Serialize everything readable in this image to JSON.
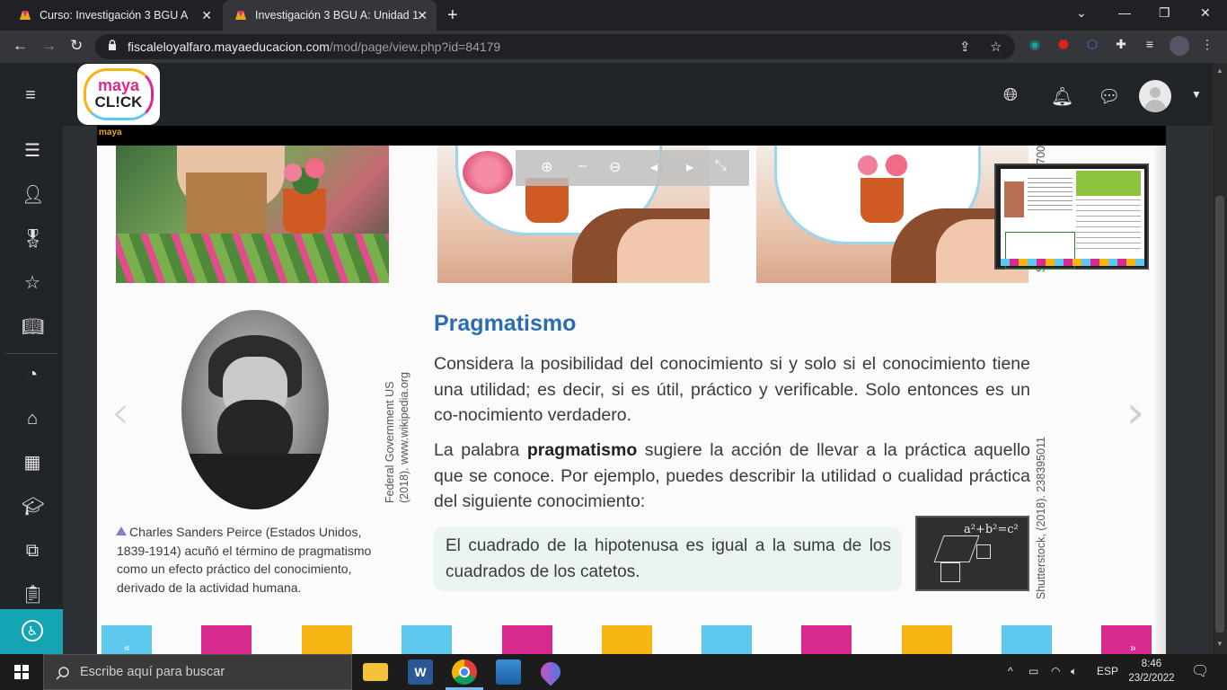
{
  "browser": {
    "tabs": [
      {
        "title": "Curso: Investigación 3 BGU A",
        "active": false
      },
      {
        "title": "Investigación 3 BGU A: Unidad 1",
        "active": true
      }
    ],
    "url_domain": "fiscaleloyalfaro.mayaeducacion.com",
    "url_path": "/mod/page/view.php?id=84179"
  },
  "header": {
    "logo_top": "maya",
    "logo_bottom": "CL!CK"
  },
  "book": {
    "brand": "maya",
    "section_title": "Pragmatismo",
    "paragraph1": "Considera la posibilidad del conocimiento si y solo si el conocimiento tiene una utilidad; es decir, si es útil, práctico y verificable. Solo entonces es un co-nocimiento verdadero.",
    "paragraph2_before": "La palabra ",
    "paragraph2_bold": "pragmatismo",
    "paragraph2_after": " sugiere la acción de llevar a la práctica aquello que se conoce. Por ejemplo, puedes describir la utilidad o cualidad práctica del siguiente conocimiento:",
    "example": "El cuadrado de la hipotenusa es igual a la suma de los cuadrados de los catetos.",
    "caption": "Charles Sanders Peirce (Estados Unidos, 1839-1914) acuñó el término de pragmatismo como un efecto práctico del conocimiento, derivado de la actividad humana.",
    "credit_portrait": "Federal Government US (2018). www.wikipedia.org",
    "credit_chalkboard": "Shutterstock, (2018). 238395011",
    "credit_top": "Sh",
    "credit_top_num": "700",
    "chalk_formula": "a²+b²=c²"
  },
  "taskbar": {
    "search_placeholder": "Escribe aquí para buscar",
    "language": "ESP",
    "time": "8:46",
    "date": "23/2/2022"
  },
  "colors": {
    "accent_blue": "#2b6cb0",
    "cyan": "#5fc8ee",
    "magenta": "#d92a8f",
    "yellow": "#f7b513"
  }
}
